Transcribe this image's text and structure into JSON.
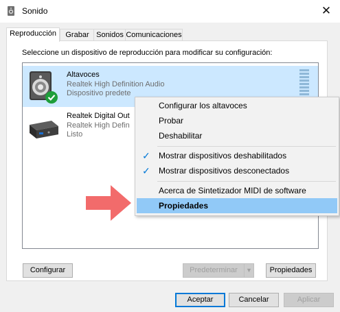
{
  "window": {
    "title": "Sonido",
    "close_glyph": "✕",
    "icon": "speaker-settings-icon"
  },
  "tabs": [
    {
      "label": "Reproducción",
      "active": true
    },
    {
      "label": "Grabar",
      "active": false
    },
    {
      "label": "Sonidos",
      "active": false
    },
    {
      "label": "Comunicaciones",
      "active": false
    }
  ],
  "instruction": "Seleccione un dispositivo de reproducción para modificar su configuración:",
  "devices": [
    {
      "name": "Altavoces",
      "driver": "Realtek High Definition Audio",
      "status": "Dispositivo predete",
      "selected": true,
      "icon": "speaker-icon",
      "badge": "default-check-icon"
    },
    {
      "name": "Realtek Digital Out",
      "driver": "Realtek High Defin",
      "status": "Listo",
      "selected": false,
      "icon": "digital-output-icon"
    }
  ],
  "context_menu": {
    "items": [
      {
        "label": "Configurar los altavoces",
        "checked": false
      },
      {
        "label": "Probar",
        "checked": false
      },
      {
        "label": "Deshabilitar",
        "checked": false
      },
      {
        "label": "Mostrar dispositivos deshabilitados",
        "checked": true
      },
      {
        "label": "Mostrar dispositivos desconectados",
        "checked": true
      },
      {
        "label": "Acerca de Sintetizador MIDI de software",
        "checked": false
      },
      {
        "label": "Propiedades",
        "checked": false,
        "highlighted": true,
        "bold": true
      }
    ],
    "check_glyph": "✓"
  },
  "panel_buttons": {
    "configurar": "Configurar",
    "predeterminar": "Predeterminar",
    "propiedades": "Propiedades",
    "dropdown_glyph": "▼"
  },
  "dialog_buttons": {
    "aceptar": "Aceptar",
    "cancelar": "Cancelar",
    "aplicar": "Aplicar"
  },
  "colors": {
    "selection": "#cce8ff",
    "menu_highlight": "#91c9f7",
    "check": "#0078d7",
    "annotation_arrow": "#f26b6b",
    "default_badge": "#1e9e3a"
  }
}
